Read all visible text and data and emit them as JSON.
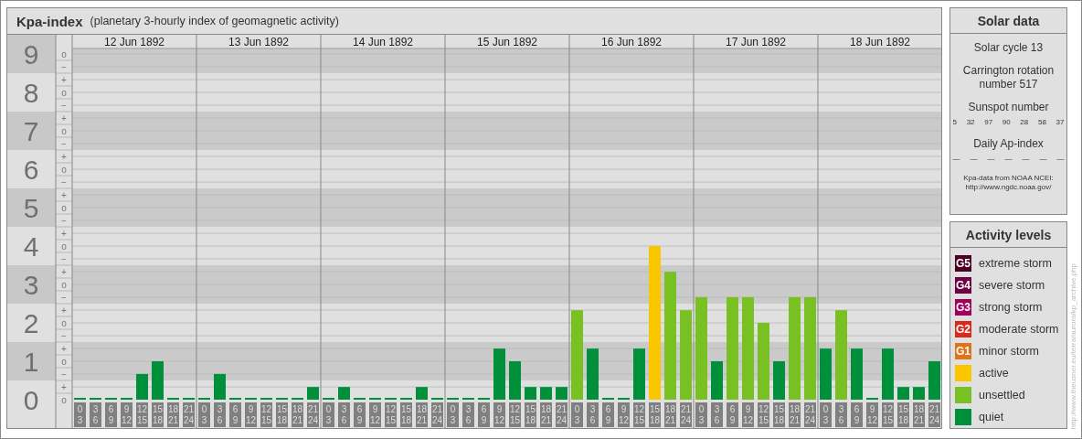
{
  "header": {
    "title": "Kpa-index",
    "subtitle": "(planetary 3-hourly index of geomagnetic activity)"
  },
  "chart": {
    "days": [
      "12 Jun 1892",
      "13 Jun 1892",
      "14 Jun 1892",
      "15 Jun 1892",
      "16 Jun 1892",
      "17 Jun 1892",
      "18 Jun 1892"
    ],
    "minor_ticks": [
      "o",
      "−",
      "+",
      "o",
      "−",
      "+",
      "o",
      "−",
      "+",
      "o",
      "−",
      "+",
      "o",
      "−",
      "+",
      "o",
      "−",
      "+",
      "o",
      "−",
      "+",
      "o",
      "−",
      "+",
      "o",
      "−",
      "+",
      "o"
    ],
    "chart_data": {
      "type": "bar",
      "grid": true,
      "ylim": [
        0,
        9
      ],
      "yticks": [
        0,
        1,
        2,
        3,
        4,
        5,
        6,
        7,
        8,
        9
      ],
      "categories": [
        "0\n3",
        "3\n6",
        "6\n9",
        "9\n12",
        "12\n15",
        "15\n18",
        "18\n21",
        "21\n24",
        "0\n3",
        "3\n6",
        "6\n9",
        "9\n12",
        "12\n15",
        "15\n18",
        "18\n21",
        "21\n24",
        "0\n3",
        "3\n6",
        "6\n9",
        "9\n12",
        "12\n15",
        "15\n18",
        "18\n21",
        "21\n24",
        "0\n3",
        "3\n6",
        "6\n9",
        "9\n12",
        "12\n15",
        "15\n18",
        "18\n21",
        "21\n24",
        "0\n3",
        "3\n6",
        "6\n9",
        "9\n12",
        "12\n15",
        "15\n18",
        "18\n21",
        "21\n24",
        "0\n3",
        "3\n6",
        "6\n9",
        "9\n12",
        "12\n15",
        "15\n18",
        "18\n21",
        "21\n24",
        "0\n3",
        "3\n6",
        "6\n9",
        "9\n12",
        "12\n15",
        "15\n18",
        "18\n21",
        "21\n24"
      ],
      "series": [
        {
          "name": "active",
          "color": "#f9c600",
          "values": [
            null,
            null,
            null,
            null,
            null,
            null,
            null,
            null,
            null,
            null,
            null,
            null,
            null,
            null,
            null,
            null,
            null,
            null,
            null,
            null,
            null,
            null,
            null,
            null,
            null,
            null,
            null,
            null,
            null,
            null,
            null,
            null,
            null,
            null,
            null,
            null,
            null,
            4,
            null,
            null,
            null,
            null,
            null,
            null,
            null,
            null,
            null,
            null,
            null,
            null,
            null,
            null,
            null,
            null,
            null,
            null
          ]
        },
        {
          "name": "unsettled",
          "color": "#79c123",
          "values": [
            null,
            null,
            null,
            null,
            null,
            null,
            null,
            null,
            null,
            null,
            null,
            null,
            null,
            null,
            null,
            null,
            null,
            null,
            null,
            null,
            null,
            null,
            null,
            null,
            null,
            null,
            null,
            null,
            null,
            null,
            null,
            null,
            2.33,
            null,
            null,
            null,
            null,
            null,
            3.33,
            2.33,
            2.67,
            null,
            2.67,
            2.67,
            2,
            null,
            2.67,
            2.67,
            null,
            2.33,
            null,
            null,
            null,
            null,
            null,
            null
          ]
        },
        {
          "name": "quiet",
          "color": "#008f3a",
          "values": [
            0,
            0,
            0,
            0,
            0.67,
            1,
            0,
            0,
            0,
            0.67,
            0,
            0,
            0,
            0,
            0,
            0.33,
            0,
            0.33,
            0,
            0,
            0,
            0,
            0.33,
            0,
            0,
            0,
            0,
            1.33,
            1,
            0.33,
            0.33,
            0.33,
            null,
            1.33,
            0,
            0,
            1.33,
            null,
            null,
            null,
            null,
            1,
            null,
            null,
            null,
            1,
            null,
            null,
            1.33,
            null,
            1.33,
            0,
            1.33,
            0.33,
            0.33,
            1
          ]
        }
      ]
    }
  },
  "solar": {
    "title": "Solar data",
    "cycle": "Solar cycle 13",
    "rotation": "Carrington rotation number 517",
    "sunspot_title": "Sunspot number",
    "sunspots": [
      "5",
      "32",
      "97",
      "90",
      "28",
      "58",
      "37"
    ],
    "ap_title": "Daily Ap-index",
    "ap_values": [
      "—",
      "—",
      "—",
      "—",
      "—",
      "—",
      "—"
    ],
    "source": "Kpa-data from NOAA NCEI:",
    "source_url": "http://www.ngdc.noaa.gov/"
  },
  "legend": {
    "title": "Activity levels",
    "items": [
      {
        "badge": "G5",
        "label": "extreme storm",
        "color": "#4b0024"
      },
      {
        "badge": "G4",
        "label": "severe storm",
        "color": "#6f0042"
      },
      {
        "badge": "G3",
        "label": "strong storm",
        "color": "#a3005c"
      },
      {
        "badge": "G2",
        "label": "moderate storm",
        "color": "#d9291a"
      },
      {
        "badge": "G1",
        "label": "minor storm",
        "color": "#e1741a"
      }
    ]
  },
  "credit": "http://www.theusner.eu/terra/aurora/kp_archive.php"
}
